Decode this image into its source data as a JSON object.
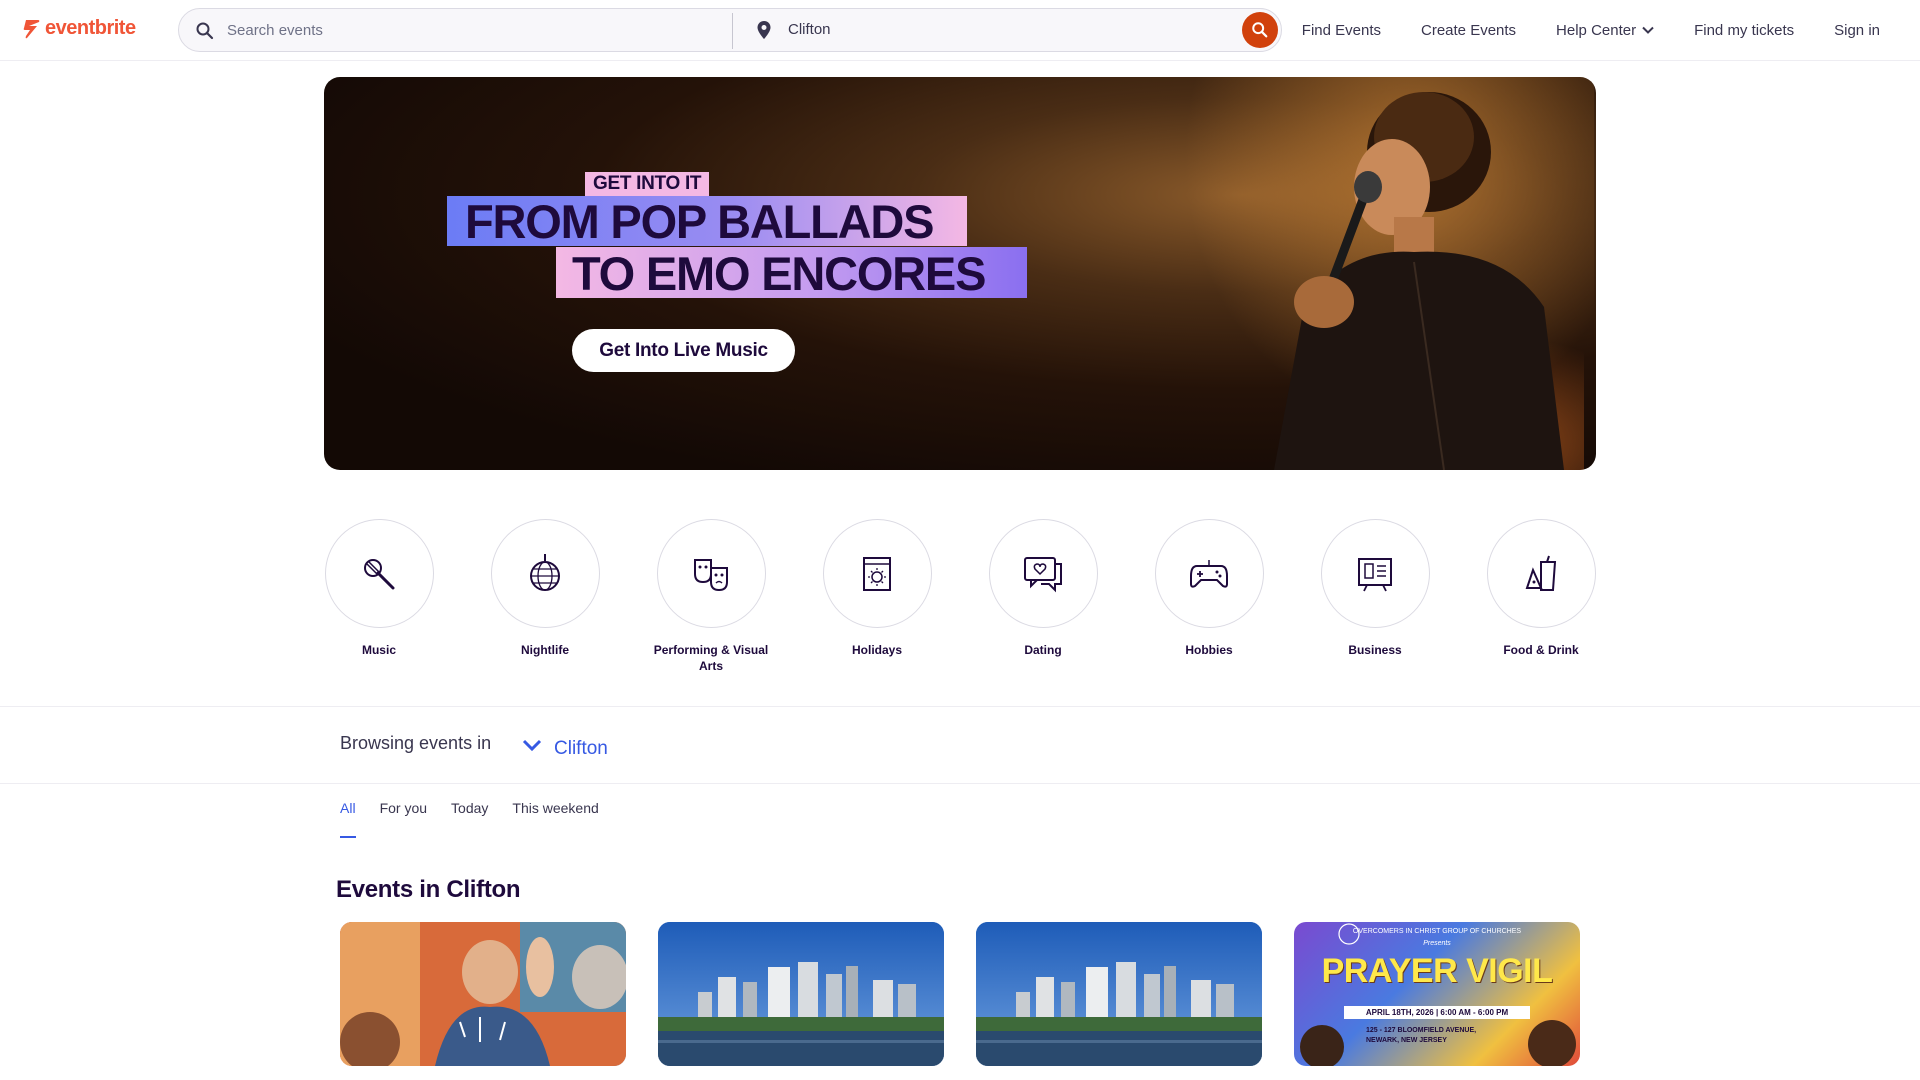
{
  "brand": {
    "name": "eventbrite",
    "color": "#f05537"
  },
  "search": {
    "placeholder": "Search events",
    "location": "Clifton"
  },
  "nav": {
    "find_events": "Find Events",
    "create_events": "Create Events",
    "help_center": "Help Center",
    "find_tickets": "Find my tickets",
    "sign_in": "Sign in"
  },
  "hero": {
    "kicker": "GET INTO IT",
    "line1": "FROM POP BALLADS",
    "line2": "TO EMO ENCORES",
    "cta": "Get Into Live Music"
  },
  "categories": [
    {
      "label": "Music",
      "icon": "microphone-icon"
    },
    {
      "label": "Nightlife",
      "icon": "disco-ball-icon"
    },
    {
      "label": "Performing & Visual Arts",
      "icon": "theater-masks-icon"
    },
    {
      "label": "Holidays",
      "icon": "calendar-sun-icon"
    },
    {
      "label": "Dating",
      "icon": "chat-heart-icon"
    },
    {
      "label": "Hobbies",
      "icon": "gamepad-icon"
    },
    {
      "label": "Business",
      "icon": "presentation-icon"
    },
    {
      "label": "Food & Drink",
      "icon": "drinks-icon"
    }
  ],
  "browse": {
    "label": "Browsing events in",
    "location": "Clifton"
  },
  "tabs": [
    "All",
    "For you",
    "Today",
    "This weekend"
  ],
  "events_section": {
    "title": "Events in Clifton"
  },
  "cards": [
    {
      "image": "people-celebrating"
    },
    {
      "image": "city-skyline"
    },
    {
      "image": "city-skyline"
    },
    {
      "image": "prayer-vigil-flyer",
      "flyer_org": "OVERCOMERS IN CHRIST GROUP OF CHURCHES",
      "flyer_presents": "Presents",
      "flyer_title": "PRAYER VIGIL",
      "flyer_date": "APRIL 18TH, 2026  |  6:00 AM - 6:00 PM",
      "flyer_address_1": "125 - 127 BLOOMFIELD AVENUE,",
      "flyer_address_2": "NEWARK, NEW JERSEY"
    }
  ]
}
